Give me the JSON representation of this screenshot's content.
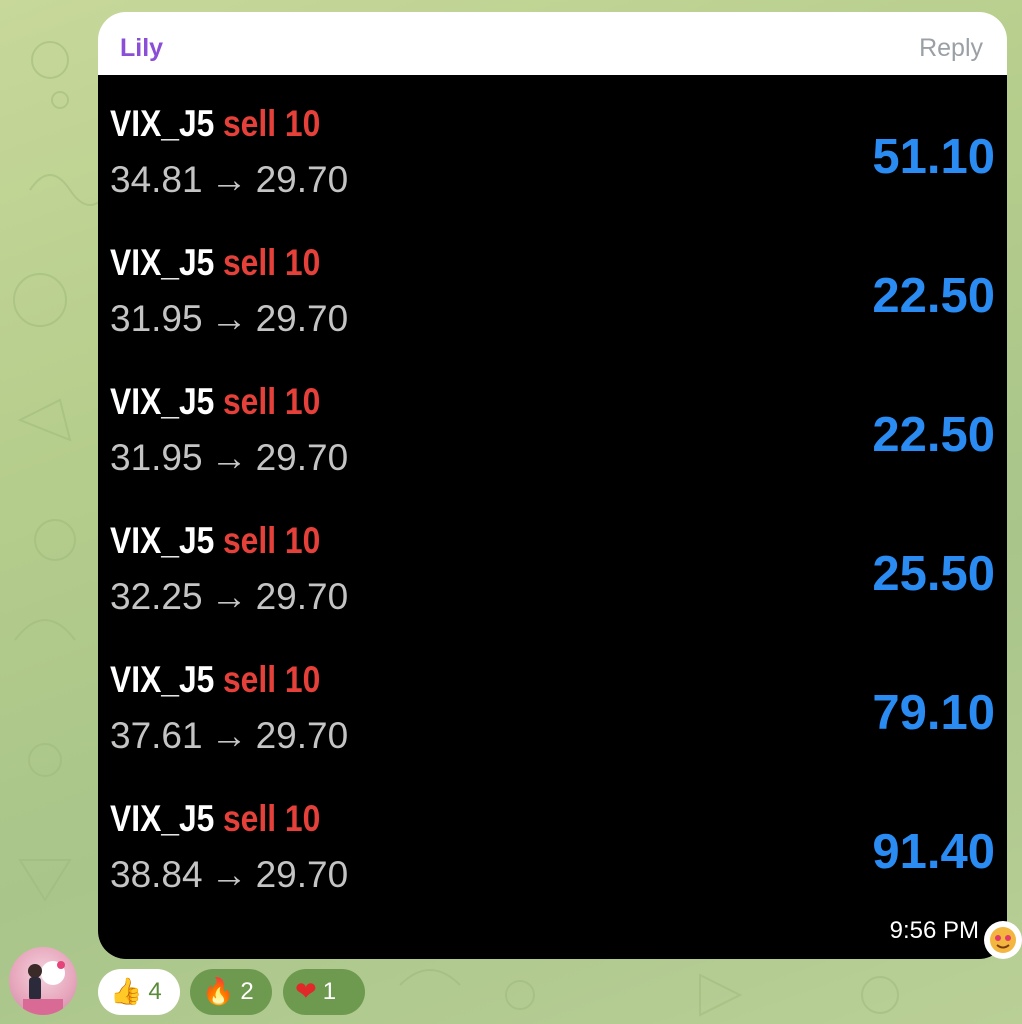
{
  "message": {
    "sender": "Lily",
    "reply_label": "Reply",
    "time": "9:56 PM"
  },
  "trades": [
    {
      "ticker": "VIX_J5",
      "action": "sell 10",
      "from": "34.81",
      "arrow": "→",
      "to": "29.70",
      "pnl": "51.10"
    },
    {
      "ticker": "VIX_J5",
      "action": "sell 10",
      "from": "31.95",
      "arrow": "→",
      "to": "29.70",
      "pnl": "22.50"
    },
    {
      "ticker": "VIX_J5",
      "action": "sell 10",
      "from": "31.95",
      "arrow": "→",
      "to": "29.70",
      "pnl": "22.50"
    },
    {
      "ticker": "VIX_J5",
      "action": "sell 10",
      "from": "32.25",
      "arrow": "→",
      "to": "29.70",
      "pnl": "25.50"
    },
    {
      "ticker": "VIX_J5",
      "action": "sell 10",
      "from": "37.61",
      "arrow": "→",
      "to": "29.70",
      "pnl": "79.10"
    },
    {
      "ticker": "VIX_J5",
      "action": "sell 10",
      "from": "38.84",
      "arrow": "→",
      "to": "29.70",
      "pnl": "91.40"
    }
  ],
  "reactions": [
    {
      "emoji": "👍",
      "count": "4",
      "icon": "thumbs-up-icon"
    },
    {
      "emoji": "🔥",
      "count": "2",
      "icon": "fire-icon"
    },
    {
      "emoji": "❤",
      "count": "1",
      "icon": "heart-icon"
    }
  ],
  "colors": {
    "sender": "#8a4fd6",
    "action": "#e5413a",
    "pnl": "#2a8cf2",
    "background": "#b5cd8c"
  }
}
